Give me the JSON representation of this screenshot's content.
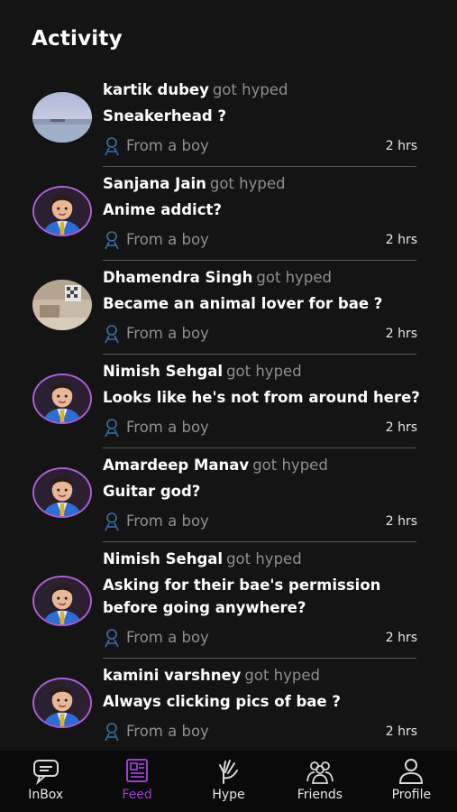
{
  "header": {
    "title": "Activity"
  },
  "feed": [
    {
      "name": "kartik dubey",
      "action": "got hyped",
      "question": "Sneakerhead ?",
      "from": "From a boy",
      "time": "2 hrs",
      "avatar": "photo-landscape"
    },
    {
      "name": "Sanjana Jain",
      "action": "got hyped",
      "question": "Anime addict?",
      "from": "From a boy",
      "time": "2 hrs",
      "avatar": "cartoon-boy"
    },
    {
      "name": "Dhamendra Singh",
      "action": "got hyped",
      "question": "Became an animal lover for bae ?",
      "from": "From a boy",
      "time": "2 hrs",
      "avatar": "photo-room"
    },
    {
      "name": "Nimish Sehgal",
      "action": "got hyped",
      "question": "Looks like he's not from around here?",
      "from": "From a boy",
      "time": "2 hrs",
      "avatar": "cartoon-boy"
    },
    {
      "name": "Amardeep Manav",
      "action": "got hyped",
      "question": "Guitar god?",
      "from": "From a boy",
      "time": "2 hrs",
      "avatar": "cartoon-boy"
    },
    {
      "name": "Nimish Sehgal",
      "action": "got hyped",
      "question": "Asking for their bae's permission before going anywhere?",
      "from": "From a boy",
      "time": "2 hrs",
      "avatar": "cartoon-boy"
    },
    {
      "name": "kamini varshney",
      "action": "got hyped",
      "question": "Always clicking pics of bae ?",
      "from": "From a boy",
      "time": "2 hrs",
      "avatar": "cartoon-boy"
    }
  ],
  "nav": [
    {
      "label": "InBox",
      "icon": "inbox-chat-icon",
      "active": false
    },
    {
      "label": "Feed",
      "icon": "feed-icon",
      "active": true
    },
    {
      "label": "Hype",
      "icon": "hype-hand-icon",
      "active": false
    },
    {
      "label": "Friends",
      "icon": "friends-icon",
      "active": false
    },
    {
      "label": "Profile",
      "icon": "profile-icon",
      "active": false
    }
  ],
  "colors": {
    "background": "#141414",
    "accent": "#9a3fd0",
    "avatar_ring": "#b05fd8",
    "muted_text": "#8f8f8f",
    "from_icon": "#3b6fb0"
  }
}
